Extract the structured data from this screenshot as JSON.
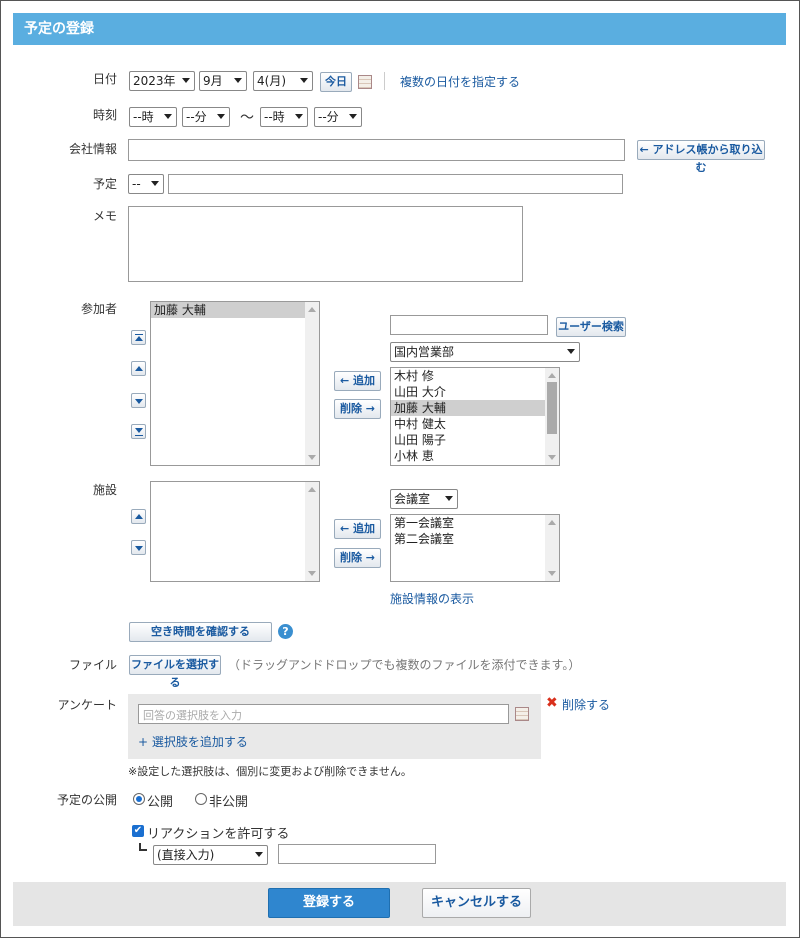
{
  "header": {
    "title": "予定の登録"
  },
  "date": {
    "label": "日付",
    "year": "2023年",
    "month": "9月",
    "day": "4(月)",
    "today_button": "今日",
    "multi_link": "複数の日付を指定する"
  },
  "time": {
    "label": "時刻",
    "start_hour": "--時",
    "start_min": "--分",
    "tilde": "〜",
    "end_hour": "--時",
    "end_min": "--分"
  },
  "company": {
    "label": "会社情報",
    "value": "",
    "address_button": "← アドレス帳から取り込む"
  },
  "schedule": {
    "label": "予定",
    "type": "--",
    "title_value": ""
  },
  "memo": {
    "label": "メモ",
    "value": ""
  },
  "participants": {
    "label": "参加者",
    "selected": [
      "加藤 大輔"
    ],
    "add_button": "← 追加",
    "remove_button": "削除 →",
    "search_value": "",
    "search_button": "ユーザー検索",
    "group": "国内営業部",
    "candidates": [
      "木村 修",
      "山田 大介",
      "加藤 大輔",
      "中村 健太",
      "山田 陽子",
      "小林 恵"
    ]
  },
  "facilities": {
    "label": "施設",
    "selected": [],
    "add_button": "← 追加",
    "remove_button": "削除 →",
    "group": "会議室",
    "candidates": [
      "第一会議室",
      "第二会議室"
    ],
    "info_link": "施設情報の表示"
  },
  "availability_button": "空き時間を確認する",
  "file": {
    "label": "ファイル",
    "select_button": "ファイルを選択する",
    "hint": "（ドラッグアンドドロップでも複数のファイルを添付できます。）"
  },
  "survey": {
    "label": "アンケート",
    "option_placeholder": "回答の選択肢を入力",
    "delete_link": "削除する",
    "add_link": "+ 選択肢を追加する",
    "note": "※設定した選択肢は、個別に変更および削除できません。"
  },
  "publish": {
    "label": "予定の公開",
    "public": "公開",
    "private": "非公開",
    "selected": "公開"
  },
  "reaction": {
    "label": "リアクションを許可する",
    "checked": true,
    "mode": "(直接入力)",
    "value": ""
  },
  "footer": {
    "register_button": "登録する",
    "cancel_button": "キャンセルする"
  },
  "colors": {
    "header_bg": "#5aaee0",
    "primary_button": "#2f86cf",
    "link": "#1a5aa0",
    "footer_bg": "#e5e5e5",
    "survey_bg": "#e9e9e9",
    "delete_x": "#d9301c"
  }
}
